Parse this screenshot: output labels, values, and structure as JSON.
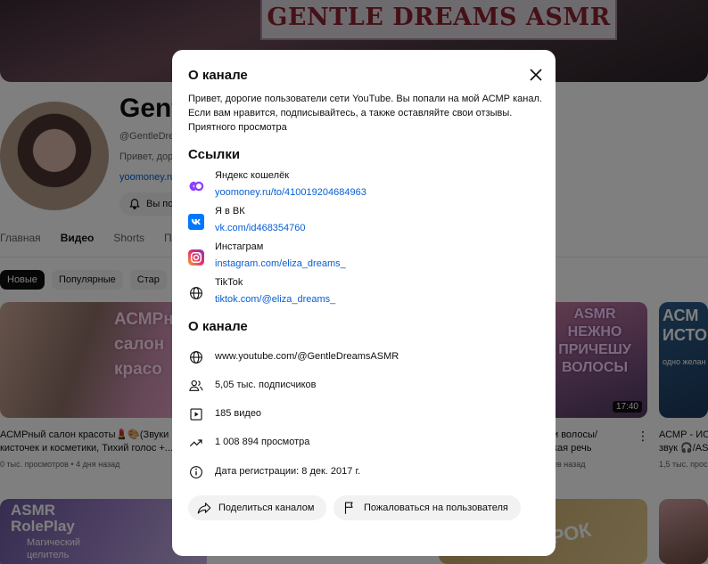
{
  "banner": {
    "title": "GENTLE DREAMS ASMR"
  },
  "channel": {
    "name": "Gent",
    "handle": "@GentleDre",
    "description": "Привет, дор",
    "link": "yoomoney.ru",
    "subscribe_label": "Вы по"
  },
  "tabs": [
    "Главная",
    "Видео",
    "Shorts",
    "Пле"
  ],
  "chips": [
    "Новые",
    "Популярные",
    "Стар"
  ],
  "videos": [
    {
      "thumb_text": "АСМРн салон красо",
      "title_line1": "АСМРный салон красоты💄🎨(Звуки",
      "title_line2": "кисточек и косметики, Тихий голос +...",
      "meta": "0 тыс. просмотров • 4 дня назад"
    },
    {
      "thumb_text": "ASMR НЕЖНО ПРИЧЕШУ ВОЛОСЫ",
      "duration": "17:40",
      "title_line1": "и волосы/",
      "title_line2": "кая речь",
      "meta": "ев назад"
    },
    {
      "thumb_text": "АСМ ИСТО",
      "thumb_sub": "одно желан",
      "title_line1": "АСМР - ИСТ",
      "title_line2": "звук 🎧/AS",
      "meta": "1,5 тыс. просмо"
    }
  ],
  "bottom_thumbs": {
    "first_title": "ASMR RolePlay",
    "first_sub": "Магический целитель",
    "second_title": "РОК"
  },
  "modal": {
    "title": "О канале",
    "description": "Привет, дорогие пользователи сети YouTube. Вы попали на мой АСМР канал. Если вам нравится, подписывайтесь, а также оставляйте свои отзывы. Приятного просмотра",
    "links_title": "Ссылки",
    "links": [
      {
        "label": "Яндекс кошелёк",
        "url": "yoomoney.ru/to/410019204684963",
        "icon": "yoomoney-icon"
      },
      {
        "label": "Я в ВК",
        "url": "vk.com/id468354760",
        "icon": "vk-icon"
      },
      {
        "label": "Инстаграм",
        "url": "instagram.com/eliza_dreams_",
        "icon": "instagram-icon"
      },
      {
        "label": "TikTok",
        "url": "tiktok.com/@eliza_dreams_",
        "icon": "globe-icon"
      }
    ],
    "about_title": "О канале",
    "info": [
      {
        "text": "www.youtube.com/@GentleDreamsASMR",
        "icon": "globe-icon"
      },
      {
        "text": "5,05 тыс. подписчиков",
        "icon": "subscribers-icon"
      },
      {
        "text": "185 видео",
        "icon": "video-icon"
      },
      {
        "text": "1 008 894 просмотра",
        "icon": "trending-icon"
      },
      {
        "text": "Дата регистрации: 8 дек. 2017 г.",
        "icon": "info-icon"
      }
    ],
    "share_label": "Поделиться каналом",
    "report_label": "Пожаловаться на пользователя"
  },
  "colors": {
    "link": "#065fd4",
    "yoomoney": "#8b3ffd",
    "vk": "#0077ff",
    "overlay": "rgba(0,0,0,0.5)"
  }
}
